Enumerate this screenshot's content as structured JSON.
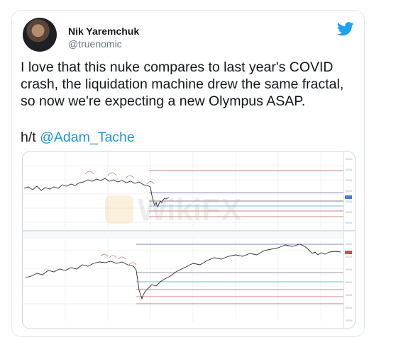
{
  "tweet": {
    "author_name": "Nik Yaremchuk",
    "author_handle": "@truenomic",
    "body": "I love that this nuke compares to last year's COVID crash, the liquidation machine drew the same fractal, so now we're expecting a new Olympus ASAP.",
    "hat_tip_prefix": "h/t ",
    "hat_tip_mention": "@Adam_Tache"
  },
  "media": {
    "watermark": "WikiFX",
    "charts": [
      "top-price-chart",
      "bottom-price-chart"
    ]
  },
  "colors": {
    "twitter_blue": "#1da1f2",
    "mention_blue": "#1b95e0",
    "text": "#14171a",
    "muted": "#657786"
  }
}
